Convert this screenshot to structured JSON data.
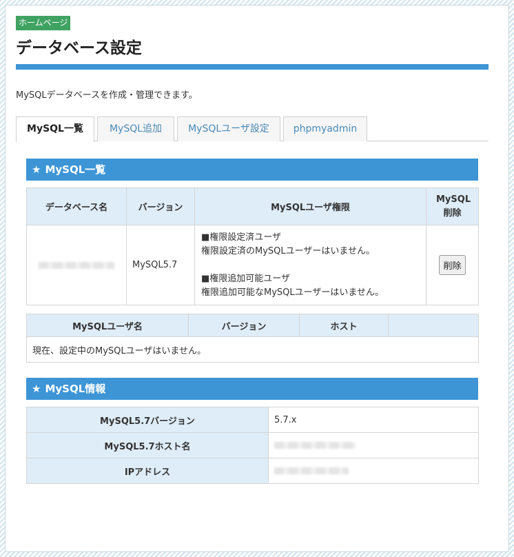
{
  "header": {
    "breadcrumb": "ホームページ",
    "title": "データベース設定",
    "description": "MySQLデータベースを作成・管理できます。"
  },
  "tabs": [
    {
      "label": "MySQL一覧",
      "active": true
    },
    {
      "label": "MySQL追加",
      "active": false
    },
    {
      "label": "MySQLユーザ設定",
      "active": false
    },
    {
      "label": "phpmyadmin",
      "active": false
    }
  ],
  "colors": {
    "accent": "#3d95d6",
    "badge": "#3fa261",
    "header_bg": "#dfedf8"
  },
  "list_section": {
    "title": "MySQL一覧",
    "icon": "star-icon",
    "db_table": {
      "headers": {
        "db_name": "データベース名",
        "version": "バージョン",
        "privileges": "MySQLユーザ権限",
        "delete": "MySQL削除"
      },
      "rows": [
        {
          "db_name": "",
          "version": "MySQL5.7",
          "set_heading": "■権限設定済ユーザ",
          "set_text": "権限設定済のMySQLユーザーはいません。",
          "addable_heading": "■権限追加可能ユーザ",
          "addable_text": "権限追加可能なMySQLユーザーはいません。",
          "delete_label": "削除"
        }
      ]
    },
    "user_table": {
      "headers": {
        "user": "MySQLユーザ名",
        "version": "バージョン",
        "host": "ホスト"
      },
      "empty_message": "現在、設定中のMySQLユーザはいません。"
    }
  },
  "info_section": {
    "title": "MySQL情報",
    "icon": "star-icon",
    "rows": [
      {
        "label": "MySQL5.7バージョン",
        "value": "5.7.x"
      },
      {
        "label": "MySQL5.7ホスト名",
        "value": ""
      },
      {
        "label": "IPアドレス",
        "value": ""
      }
    ]
  }
}
